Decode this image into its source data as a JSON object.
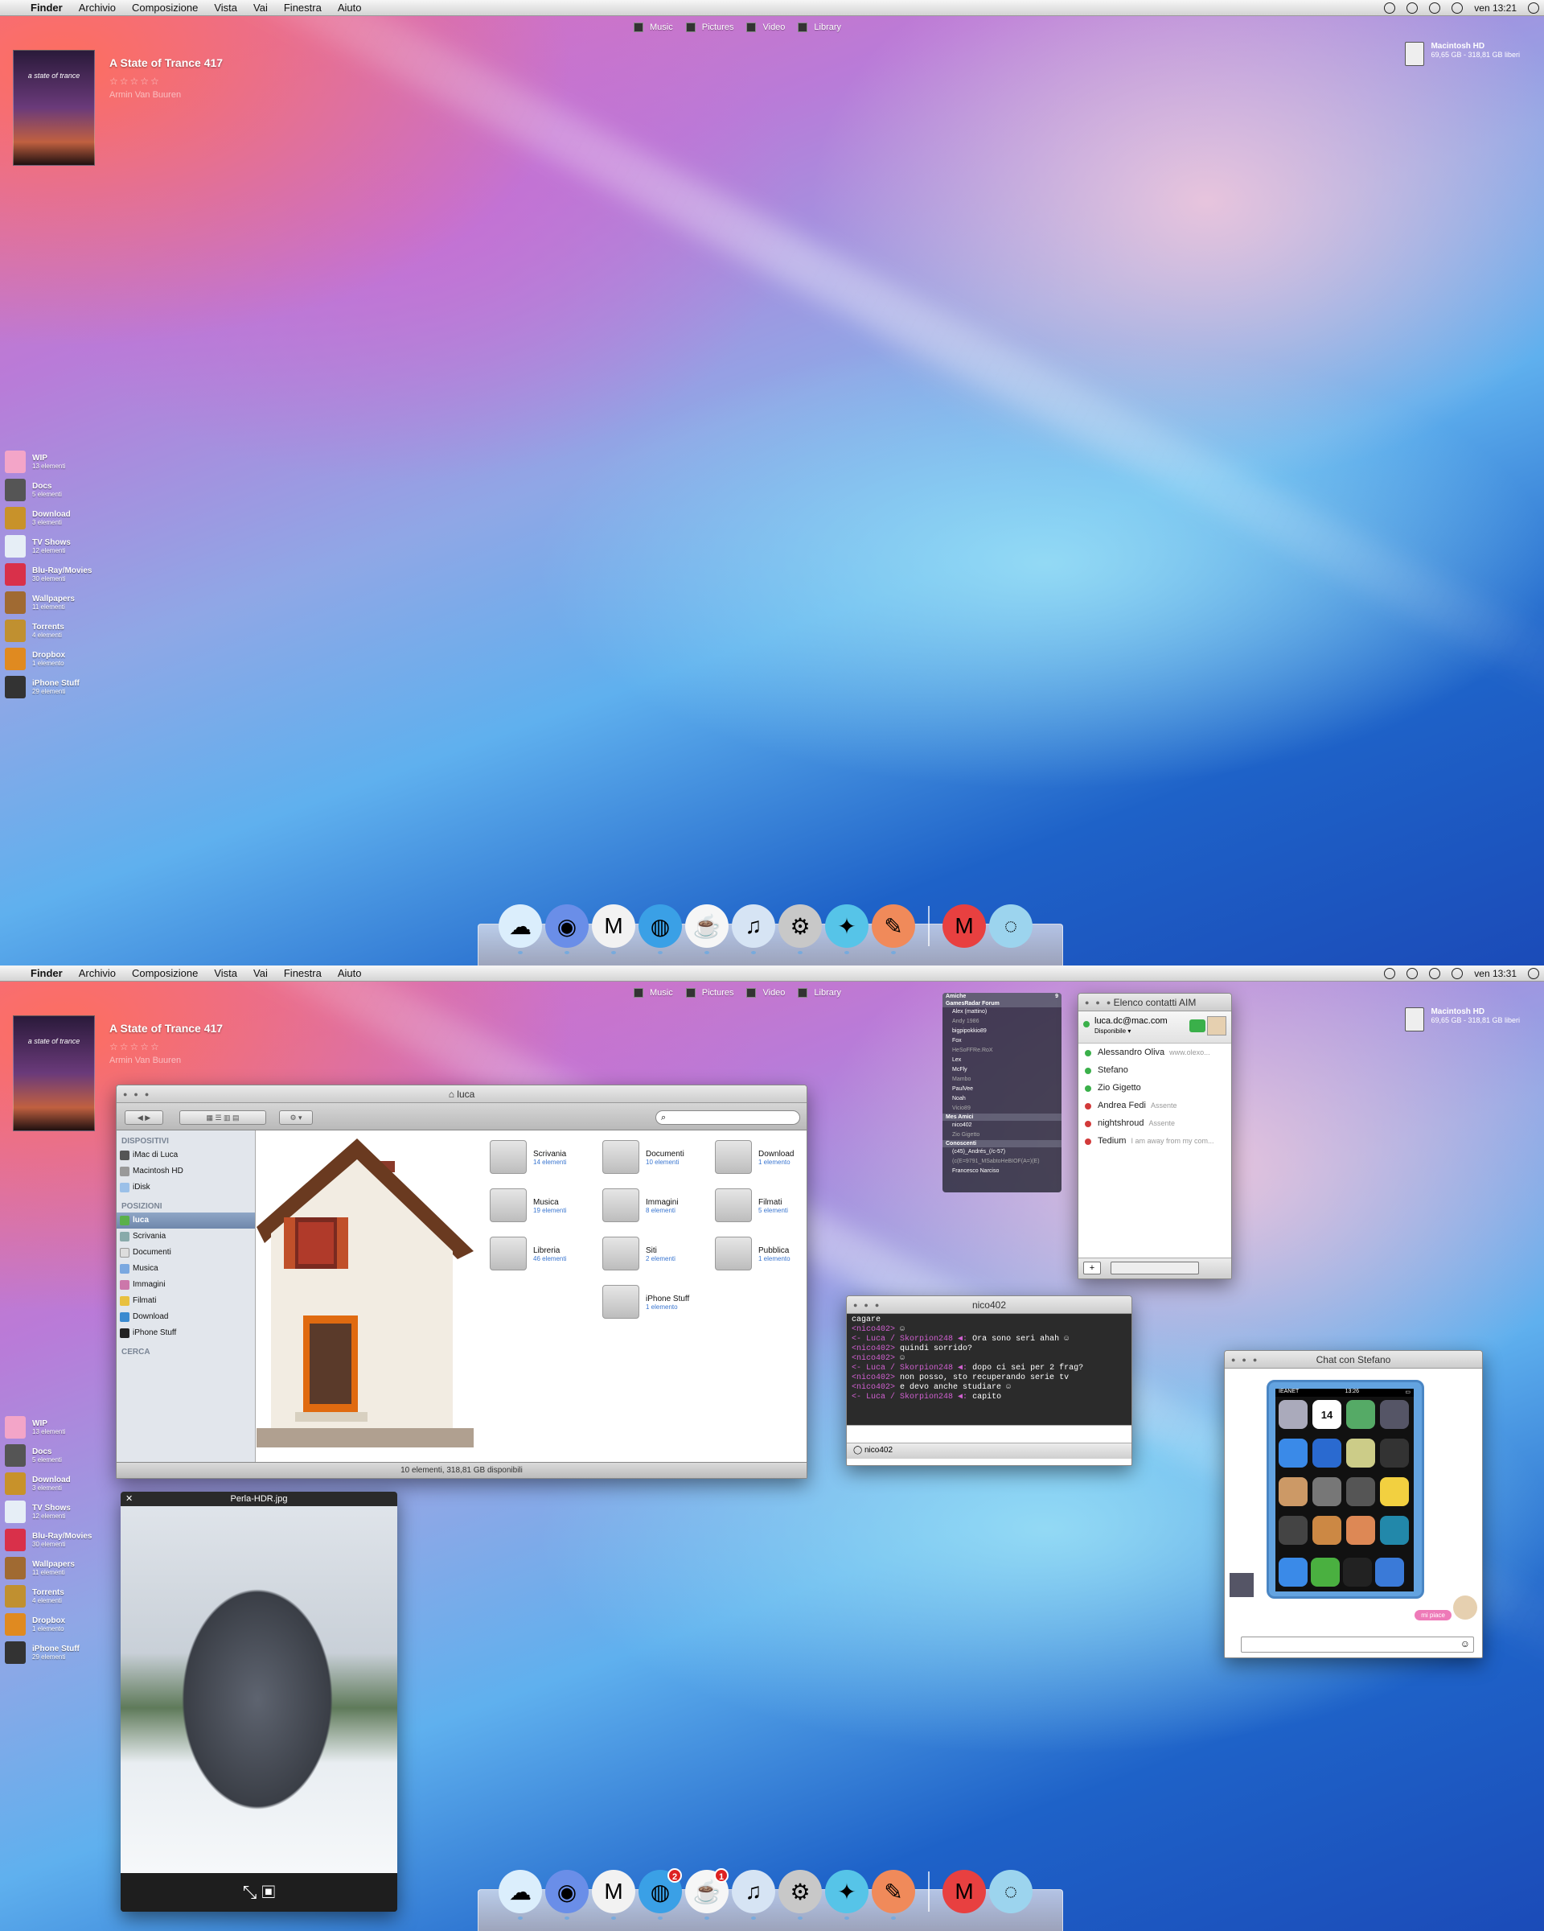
{
  "screens": [
    {
      "clock": "ven 13:21"
    },
    {
      "clock": "ven 13:31"
    }
  ],
  "menubar": {
    "app": "Finder",
    "items": [
      "Archivio",
      "Composizione",
      "Vista",
      "Vai",
      "Finestra",
      "Aiuto"
    ]
  },
  "places": [
    "Music",
    "Pictures",
    "Video",
    "Library"
  ],
  "itunes": {
    "cover_text": "a state of trance",
    "title": "A State of Trance 417",
    "stars": "☆☆☆☆☆",
    "artist": "Armin Van Buuren"
  },
  "disk": {
    "name": "Macintosh HD",
    "info": "69,65 GB - 318,81 GB liberi"
  },
  "stacks": [
    {
      "name": "WIP",
      "count": "13 elementi",
      "color": "#f3a5c8"
    },
    {
      "name": "Docs",
      "count": "5 elementi",
      "color": "#555"
    },
    {
      "name": "Download",
      "count": "3 elementi",
      "color": "#c8922a"
    },
    {
      "name": "TV Shows",
      "count": "12 elementi",
      "color": "#e6eef6"
    },
    {
      "name": "Blu-Ray/Movies",
      "count": "30 elementi",
      "color": "#d9304a"
    },
    {
      "name": "Wallpapers",
      "count": "11 elementi",
      "color": "#a06a32"
    },
    {
      "name": "Torrents",
      "count": "4 elementi",
      "color": "#c09030"
    },
    {
      "name": "Dropbox",
      "count": "1 elemento",
      "color": "#e08a20"
    },
    {
      "name": "iPhone Stuff",
      "count": "29 elementi",
      "color": "#333"
    }
  ],
  "dock": {
    "icons": [
      {
        "name": "icloud-icon",
        "glyph": "☁",
        "bg": "#dbeefc",
        "badge": ""
      },
      {
        "name": "firefox-icon",
        "glyph": "◉",
        "bg": "#6a8ee8",
        "badge": ""
      },
      {
        "name": "gmail-icon",
        "glyph": "M",
        "bg": "#f2f2f2",
        "badge": ""
      },
      {
        "name": "messages-icon",
        "glyph": "◍",
        "bg": "#3aa0e6",
        "badge": "2"
      },
      {
        "name": "coffee-icon",
        "glyph": "☕",
        "bg": "#f6f6f6",
        "badge": "1"
      },
      {
        "name": "itunes-icon",
        "glyph": "♫",
        "bg": "#d6e4f4",
        "badge": ""
      },
      {
        "name": "settings-icon",
        "glyph": "⚙",
        "bg": "#c8c8c8",
        "badge": ""
      },
      {
        "name": "bird-icon",
        "glyph": "✦",
        "bg": "#56c4e8",
        "badge": ""
      },
      {
        "name": "feather-icon",
        "glyph": "✎",
        "bg": "#f08a5a",
        "badge": ""
      },
      {
        "name": "mario-icon",
        "glyph": "M",
        "bg": "#e84040",
        "badge": ""
      },
      {
        "name": "goldfish-icon",
        "glyph": "◌",
        "bg": "#9cd4ee",
        "badge": ""
      }
    ]
  },
  "finder": {
    "title": "luca",
    "search_placeholder": "",
    "sidebar": {
      "devices_header": "DISPOSITIVI",
      "devices": [
        "iMac di Luca",
        "Macintosh HD",
        "iDisk"
      ],
      "places_header": "POSIZIONI",
      "places": [
        "luca",
        "Scrivania",
        "Documenti",
        "Musica",
        "Immagini",
        "Filmati",
        "Download",
        "iPhone Stuff"
      ],
      "search_header": "CERCA"
    },
    "items": [
      {
        "name": "Scrivania",
        "count": "14 elementi"
      },
      {
        "name": "Documenti",
        "count": "10 elementi"
      },
      {
        "name": "Download",
        "count": "1 elemento"
      },
      {
        "name": "Musica",
        "count": "19 elementi"
      },
      {
        "name": "Immagini",
        "count": "8 elementi"
      },
      {
        "name": "Filmati",
        "count": "5 elementi"
      },
      {
        "name": "Libreria",
        "count": "46 elementi"
      },
      {
        "name": "Siti",
        "count": "2 elementi"
      },
      {
        "name": "Pubblica",
        "count": "1 elemento"
      },
      {
        "name": "iPhone Stuff",
        "count": "1 elemento"
      }
    ],
    "status": "10 elementi, 318,81 GB disponibili"
  },
  "quicklook": {
    "title": "Perla-HDR.jpg"
  },
  "buddylist": {
    "groups": [
      {
        "name": "Amiche",
        "count": "9"
      },
      {
        "name": "GamesRadar Forum",
        "members": [
          "Alex (mattino)",
          "Andy 1986",
          "bigpipokkio89",
          "Fox",
          "HeSoFFRe.RoX",
          "Lex",
          "McFly",
          "Mambo",
          "PaulVee",
          "Noah",
          "Vicio89"
        ]
      },
      {
        "name": "Mes Amici",
        "members": [
          "nico402",
          "Zio Gigetto"
        ]
      },
      {
        "name": "Conoscenti",
        "members": [
          "(c45)_Andrés_(/c-57)",
          "(c(E=9791_MSabtoHeBIOF(A=)(E)",
          "Francesco Narciso"
        ]
      }
    ]
  },
  "aim": {
    "title": "Elenco contatti AIM",
    "account": "luca.dc@mac.com",
    "status": "Disponibile",
    "contacts": [
      {
        "name": "Alessandro Oliva",
        "sub": "www.olexo...",
        "color": "#3ab04a"
      },
      {
        "name": "Stefano",
        "sub": "",
        "color": "#3ab04a"
      },
      {
        "name": "Zio Gigetto",
        "sub": "",
        "color": "#3ab04a"
      },
      {
        "name": "Andrea Fedi",
        "sub": "Assente",
        "color": "#d23a3a"
      },
      {
        "name": "nightshroud",
        "sub": "Assente",
        "color": "#d23a3a"
      },
      {
        "name": "Tedium",
        "sub": "I am away from my com...",
        "color": "#d23a3a"
      }
    ]
  },
  "terminal": {
    "title": "nico402",
    "lines": [
      {
        "who": "",
        "text": "cagare"
      },
      {
        "who": "<nico402>",
        "text": "☺"
      },
      {
        "who": "<- Luca / Skorpion248 ◀:",
        "text": "Ora sono seri ahah ☺"
      },
      {
        "who": "<nico402>",
        "text": "quindi sorrido?"
      },
      {
        "who": "<nico402>",
        "text": "☺"
      },
      {
        "who": "<- Luca / Skorpion248 ◀:",
        "text": "dopo ci sei per 2 frag?"
      },
      {
        "who": "<nico402>",
        "text": "non posso, sto recuperando serie tv"
      },
      {
        "who": "<nico402>",
        "text": "e devo anche studiare ☺"
      },
      {
        "who": "<- Luca / Skorpion248 ◀:",
        "text": "capito"
      }
    ],
    "footer": "nico402"
  },
  "chat": {
    "title": "Chat con Stefano",
    "carrier": "IEANET",
    "time": "13:26",
    "calendar_day": "14",
    "bubble": "mi piace"
  }
}
